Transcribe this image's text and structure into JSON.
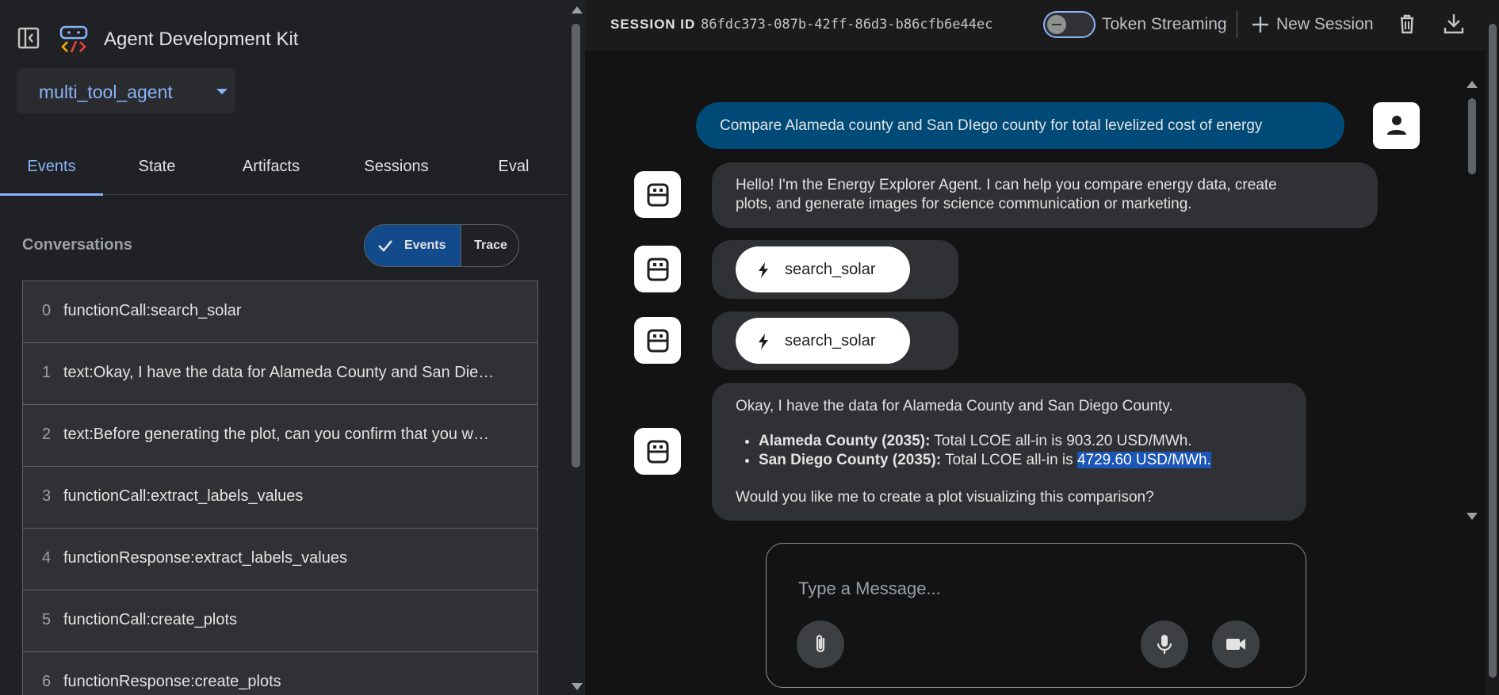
{
  "app": {
    "title": "Agent Development Kit"
  },
  "agent_select": {
    "value": "multi_tool_agent"
  },
  "tabs": [
    {
      "label": "Events"
    },
    {
      "label": "State"
    },
    {
      "label": "Artifacts"
    },
    {
      "label": "Sessions"
    },
    {
      "label": "Eval"
    }
  ],
  "conversations": {
    "title": "Conversations",
    "toggle": {
      "events": "Events",
      "trace": "Trace"
    },
    "items": [
      {
        "index": "0",
        "text": "functionCall:search_solar"
      },
      {
        "index": "1",
        "text": "text:Okay, I have the data for Alameda County and San Die…"
      },
      {
        "index": "2",
        "text": "text:Before generating the plot, can you confirm that you w…"
      },
      {
        "index": "3",
        "text": "functionCall:extract_labels_values"
      },
      {
        "index": "4",
        "text": "functionResponse:extract_labels_values"
      },
      {
        "index": "5",
        "text": "functionCall:create_plots"
      },
      {
        "index": "6",
        "text": "functionResponse:create_plots"
      }
    ]
  },
  "topbar": {
    "session_label": "SESSION ID",
    "session_id": "86fdc373-087b-42ff-86d3-b86cfb6e44ec",
    "token_streaming": "Token Streaming",
    "new_session": "New Session"
  },
  "chat": {
    "user_message": "Compare Alameda county and San DIego county for total levelized cost of energy",
    "bot_greeting_line1": "Hello! I'm the Energy Explorer Agent. I can help you compare energy data, create",
    "bot_greeting_line2": "plots, and generate images for science communication or marketing.",
    "tool_call_1": "search_solar",
    "tool_call_2": "search_solar",
    "result_intro": "Okay, I have the data for Alameda County and San Diego County.",
    "bullet1_label": "Alameda County (2035):",
    "bullet1_text": "Total LCOE all-in is 903.20 USD/MWh.",
    "bullet2_label": "San Diego County (2035):",
    "bullet2_text_a": "Total LCOE all-in is",
    "bullet2_text_b": "4729.60 USD/MWh.",
    "result_question": "Would you like me to create a plot visualizing this comparison?"
  },
  "composer": {
    "placeholder": "Type a Message..."
  },
  "colors": {
    "accent": "#8ab4f8",
    "user_bubble": "#004a77",
    "bot_bubble": "#303134"
  }
}
